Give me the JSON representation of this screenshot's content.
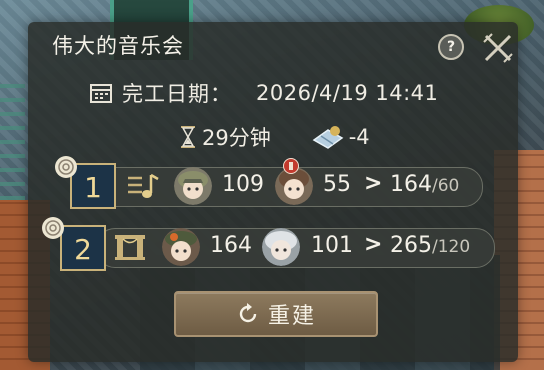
{
  "dialog": {
    "title": "伟大的音乐会",
    "help_label": "?",
    "completion_label": "完工日期：",
    "completion_value": "2026/4/19 14:41",
    "duration": "29分钟",
    "cost": "-4"
  },
  "rows": [
    {
      "rank": "1",
      "type_icon": "music-note-icon",
      "char1_value": "109",
      "char2_value": "55",
      "arrow": ">",
      "total": "164",
      "target": "/60"
    },
    {
      "rank": "2",
      "type_icon": "stage-icon",
      "char1_value": "164",
      "char2_value": "101",
      "arrow": ">",
      "total": "265",
      "target": "/120"
    }
  ],
  "rebuild_button": {
    "label": "重建",
    "icon": "refresh-icon"
  },
  "colors": {
    "panel": "#282c28",
    "rank_box": "#1c3347",
    "rank_border": "#c9b27a",
    "button": "#7d6a50"
  }
}
